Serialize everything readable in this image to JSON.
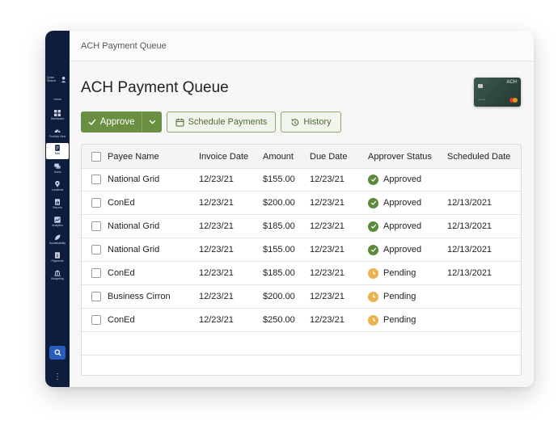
{
  "window": {
    "title": "ACH Payment Queue"
  },
  "sidebar": {
    "search_label": "Quick Search",
    "home_label": "Home",
    "items": [
      {
        "label": "Dashboard",
        "icon": "grid-icon"
      },
      {
        "label": "Portfolio View",
        "icon": "gauge-icon"
      },
      {
        "label": "Bills",
        "icon": "document-icon",
        "active": true
      },
      {
        "label": "Users",
        "icon": "chat-icon"
      },
      {
        "label": "Locations",
        "icon": "pin-icon"
      },
      {
        "label": "Reports",
        "icon": "report-icon"
      },
      {
        "label": "Analytics",
        "icon": "chart-icon"
      },
      {
        "label": "Sustainability",
        "icon": "leaf-icon"
      },
      {
        "label": "Payments",
        "icon": "dollar-document-icon"
      },
      {
        "label": "Budgeting",
        "icon": "bank-icon"
      }
    ]
  },
  "page": {
    "title": "ACH Payment Queue"
  },
  "card": {
    "label": "ACH",
    "number": "•••• ••••"
  },
  "toolbar": {
    "approve_label": "Approve",
    "schedule_label": "Schedule Payments",
    "history_label": "History"
  },
  "table": {
    "columns": [
      "Payee Name",
      "Invoice Date",
      "Amount",
      "Due Date",
      "Approver Status",
      "Scheduled Date"
    ],
    "rows": [
      {
        "payee": "National Grid",
        "invoice_date": "12/23/21",
        "amount": "$155.00",
        "due_date": "12/23/21",
        "status": "Approved",
        "scheduled": ""
      },
      {
        "payee": "ConEd",
        "invoice_date": "12/23/21",
        "amount": "$200.00",
        "due_date": "12/23/21",
        "status": "Approved",
        "scheduled": "12/13/2021"
      },
      {
        "payee": "National Grid",
        "invoice_date": "12/23/21",
        "amount": "$185.00",
        "due_date": "12/23/21",
        "status": "Approved",
        "scheduled": "12/13/2021"
      },
      {
        "payee": "National Grid",
        "invoice_date": "12/23/21",
        "amount": "$155.00",
        "due_date": "12/23/21",
        "status": "Approved",
        "scheduled": "12/13/2021"
      },
      {
        "payee": "ConEd",
        "invoice_date": "12/23/21",
        "amount": "$185.00",
        "due_date": "12/23/21",
        "status": "Pending",
        "scheduled": "12/13/2021"
      },
      {
        "payee": "Business Cirron",
        "invoice_date": "12/23/21",
        "amount": "$200.00",
        "due_date": "12/23/21",
        "status": "Pending",
        "scheduled": ""
      },
      {
        "payee": "ConEd",
        "invoice_date": "12/23/21",
        "amount": "$250.00",
        "due_date": "12/23/21",
        "status": "Pending",
        "scheduled": ""
      }
    ]
  },
  "colors": {
    "sidebar": "#0f1d3d",
    "accent_green": "#6b8f42",
    "approved": "#5a8a3c",
    "pending": "#e8b450"
  }
}
